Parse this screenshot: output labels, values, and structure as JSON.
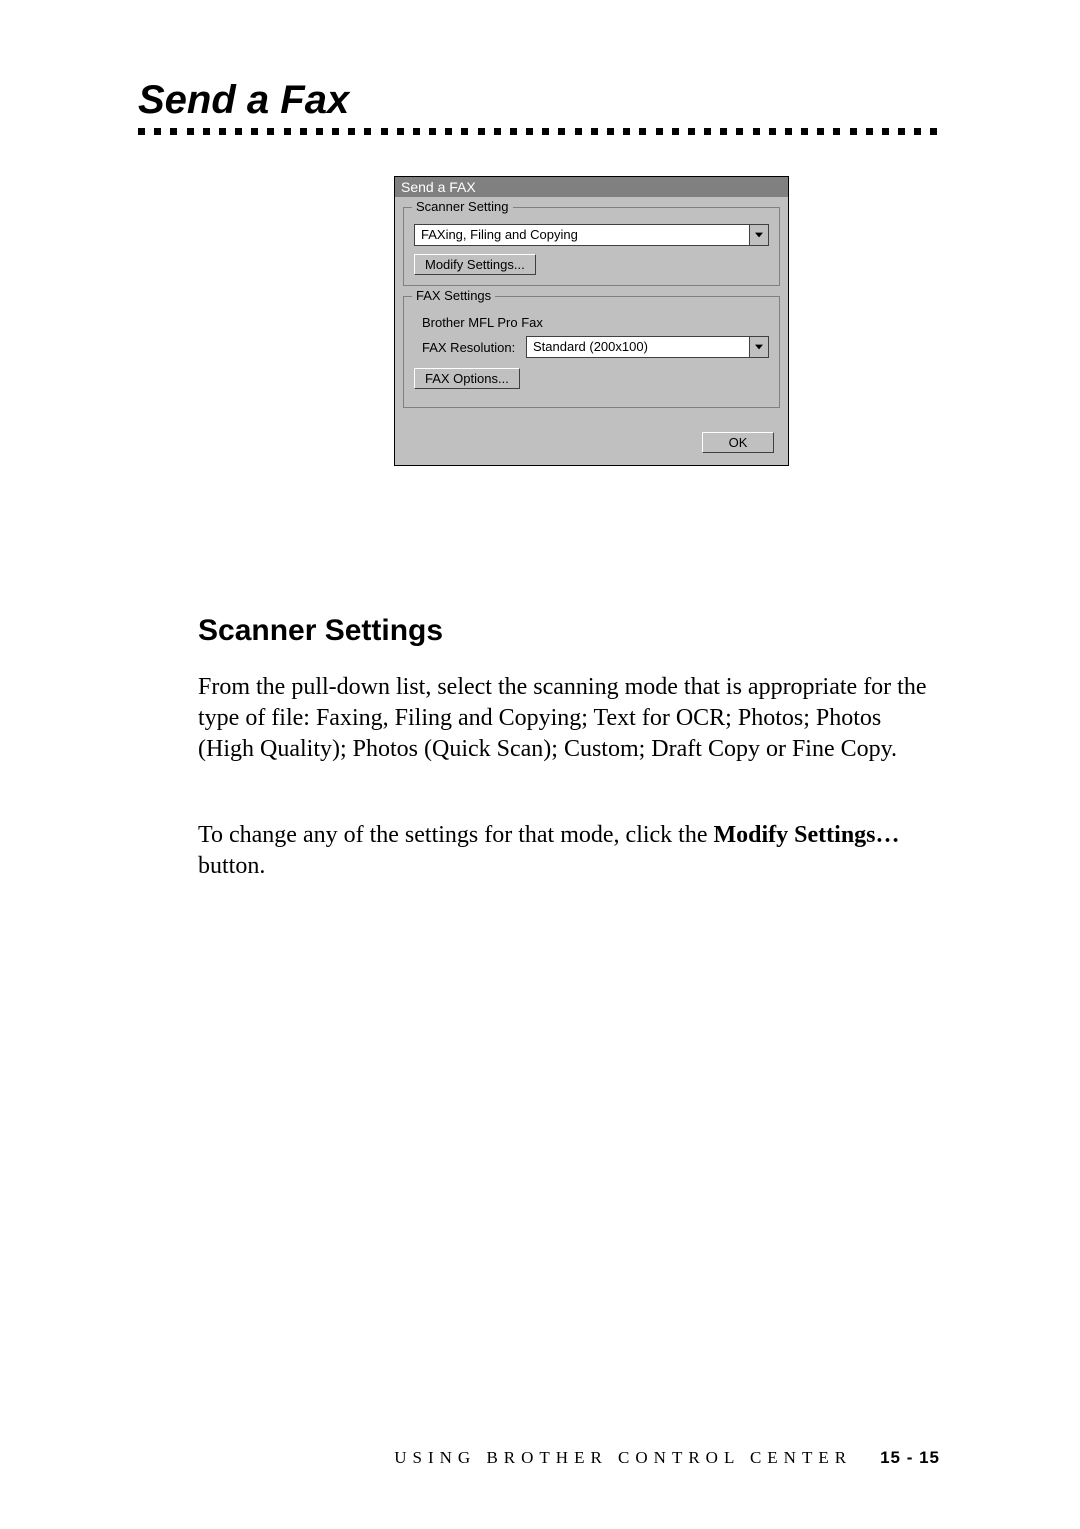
{
  "heading": "Send a Fax",
  "dialog": {
    "title": "Send a FAX",
    "scanner_group": {
      "legend": "Scanner Setting",
      "mode_selected": "FAXing, Filing and Copying",
      "modify_btn": "Modify Settings..."
    },
    "fax_group": {
      "legend": "FAX Settings",
      "brand": "Brother MFL Pro Fax",
      "res_label": "FAX Resolution:",
      "res_selected": "Standard (200x100)",
      "options_btn": "FAX Options..."
    },
    "ok_btn": "OK"
  },
  "subheading": "Scanner Settings",
  "para1": "From the pull-down list, select the scanning mode that is appropriate for the type of file:  Faxing, Filing and Copying; Text for OCR; Photos; Photos (High Quality); Photos (Quick Scan); Custom; Draft Copy or Fine Copy.",
  "para2_a": "To change any of the settings for that mode, click the ",
  "para2_b": "Modify Settings…",
  "para2_c": " button.",
  "footer_text": "USING BROTHER CONTROL CENTER",
  "footer_page": "15 - 15"
}
